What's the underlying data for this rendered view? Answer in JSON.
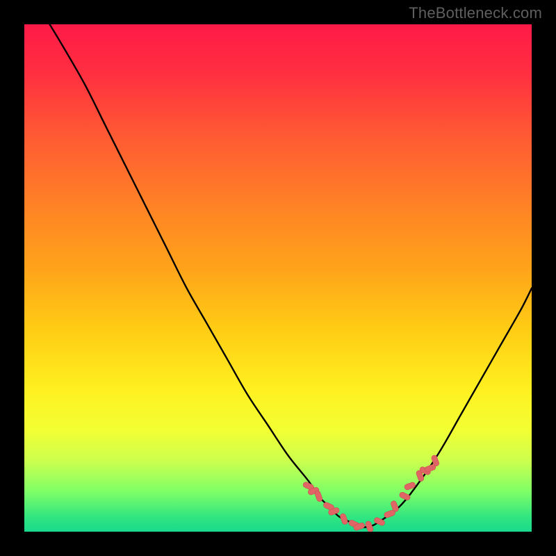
{
  "watermark": "TheBottleneck.com",
  "colors": {
    "page_bg": "#000000",
    "curve": "#000000",
    "markers_fill": "#e06666",
    "markers_stroke": "#cc4d52",
    "gradient_stops": [
      {
        "offset": 0.0,
        "color": "#ff1a47"
      },
      {
        "offset": 0.1,
        "color": "#ff3040"
      },
      {
        "offset": 0.22,
        "color": "#ff5a33"
      },
      {
        "offset": 0.35,
        "color": "#ff8026"
      },
      {
        "offset": 0.48,
        "color": "#ffa31a"
      },
      {
        "offset": 0.6,
        "color": "#ffcc14"
      },
      {
        "offset": 0.72,
        "color": "#fff020"
      },
      {
        "offset": 0.8,
        "color": "#f2ff33"
      },
      {
        "offset": 0.86,
        "color": "#ccff4d"
      },
      {
        "offset": 0.92,
        "color": "#80ff66"
      },
      {
        "offset": 0.97,
        "color": "#33e680"
      },
      {
        "offset": 1.0,
        "color": "#19d98c"
      }
    ]
  },
  "chart_data": {
    "type": "line",
    "title": "",
    "xlabel": "",
    "ylabel": "",
    "xlim": [
      0,
      100
    ],
    "ylim": [
      0,
      100
    ],
    "series": [
      {
        "name": "bottleneck-curve",
        "x": [
          5,
          8,
          12,
          16,
          20,
          24,
          28,
          32,
          36,
          40,
          44,
          48,
          52,
          56,
          58,
          60,
          62,
          64,
          66,
          68,
          70,
          74,
          78,
          82,
          86,
          90,
          94,
          98,
          100
        ],
        "y": [
          100,
          95,
          88,
          80,
          72,
          64,
          56,
          48,
          41,
          34,
          27,
          21,
          15,
          10,
          7,
          5,
          3,
          2,
          1,
          1,
          2,
          5,
          10,
          16,
          23,
          30,
          37,
          44,
          48
        ]
      }
    ],
    "markers": {
      "name": "highlight-points",
      "x": [
        56,
        57,
        58,
        60,
        61,
        63,
        65,
        66,
        68,
        70,
        72,
        73,
        75,
        76,
        78,
        79,
        80,
        81
      ],
      "y": [
        9,
        8,
        7,
        5,
        4,
        2.5,
        1.5,
        1,
        1,
        2,
        3.5,
        5,
        7,
        9,
        11,
        12,
        12.5,
        14
      ]
    }
  }
}
